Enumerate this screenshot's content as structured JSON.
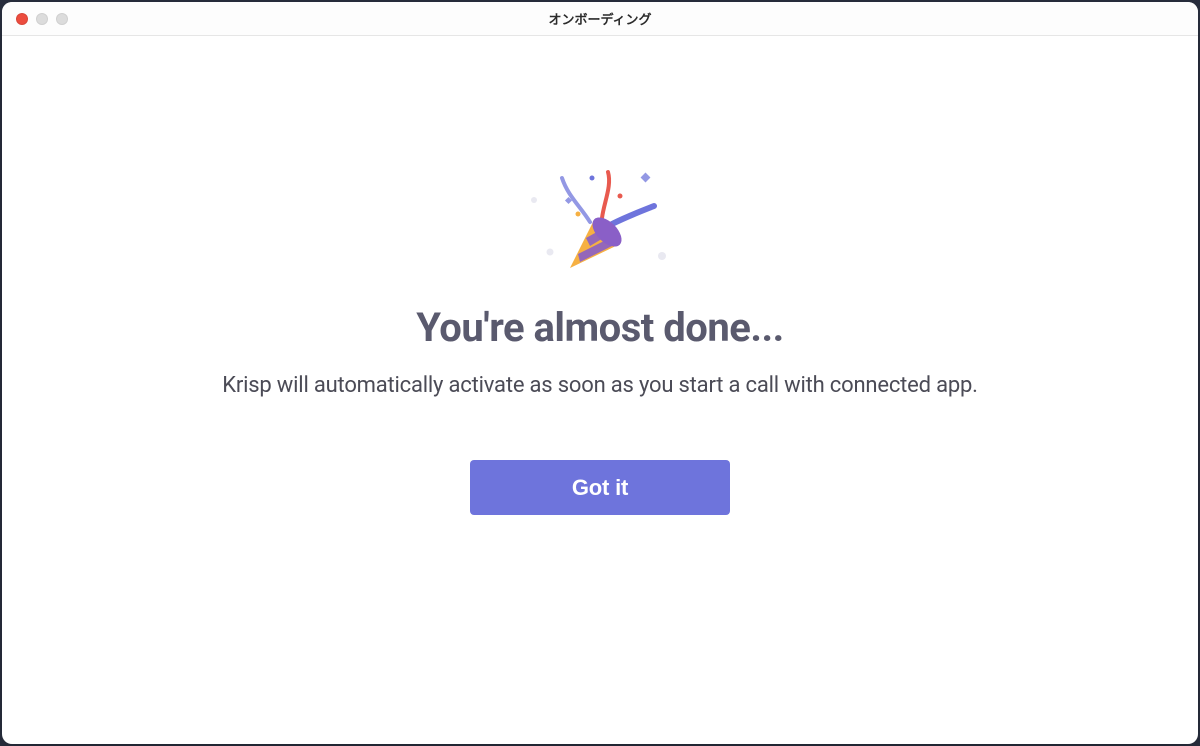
{
  "window": {
    "title": "オンボーディング"
  },
  "main": {
    "heading": "You're almost done...",
    "subtext": "Krisp will automatically activate as soon as you start a call with connected app.",
    "primary_button_label": "Got it"
  },
  "icons": {
    "illustration": "party-popper"
  },
  "colors": {
    "accent": "#6e74dc",
    "heading": "#5a5a6e",
    "text": "#4b4b56"
  }
}
